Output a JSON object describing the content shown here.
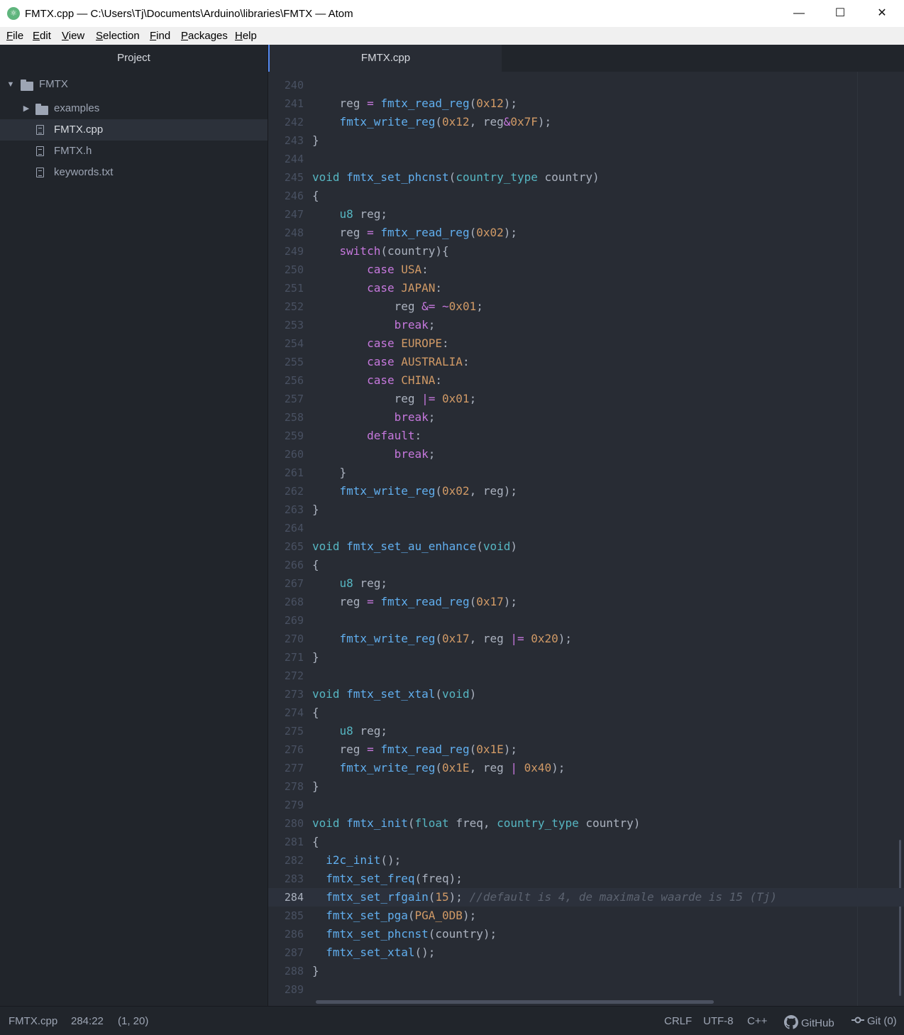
{
  "window": {
    "title": "FMTX.cpp — C:\\Users\\Tj\\Documents\\Arduino\\libraries\\FMTX — Atom",
    "app_icon": "atom-icon",
    "minimize": "—",
    "maximize": "☐",
    "close": "✕"
  },
  "menu": [
    {
      "key": "F",
      "rest": "ile"
    },
    {
      "key": "E",
      "rest": "dit"
    },
    {
      "key": "V",
      "rest": "iew"
    },
    {
      "key": "S",
      "rest": "election"
    },
    {
      "key": "F",
      "rest": "ind"
    },
    {
      "key": "P",
      "rest": "ackages"
    },
    {
      "key": "H",
      "rest": "elp"
    }
  ],
  "sidebar": {
    "header": "Project",
    "root": "FMTX",
    "items": [
      {
        "label": "examples",
        "type": "folder"
      },
      {
        "label": "FMTX.cpp",
        "type": "file",
        "selected": true
      },
      {
        "label": "FMTX.h",
        "type": "file"
      },
      {
        "label": "keywords.txt",
        "type": "file"
      }
    ]
  },
  "tab": {
    "label": "FMTX.cpp"
  },
  "editor": {
    "current_line": 284,
    "lines": [
      {
        "n": "240",
        "s": []
      },
      {
        "n": "241",
        "s": [
          [
            "p",
            "    reg "
          ],
          [
            "o",
            "="
          ],
          [
            "p",
            " "
          ],
          [
            "f",
            "fmtx_read_reg"
          ],
          [
            "p",
            "("
          ],
          [
            "n",
            "0x12"
          ],
          [
            "p",
            ");"
          ]
        ]
      },
      {
        "n": "242",
        "s": [
          [
            "p",
            "    "
          ],
          [
            "f",
            "fmtx_write_reg"
          ],
          [
            "p",
            "("
          ],
          [
            "n",
            "0x12"
          ],
          [
            "p",
            ", reg"
          ],
          [
            "o",
            "&"
          ],
          [
            "n",
            "0x7F"
          ],
          [
            "p",
            ");"
          ]
        ]
      },
      {
        "n": "243",
        "s": [
          [
            "p",
            "}"
          ]
        ]
      },
      {
        "n": "244",
        "s": []
      },
      {
        "n": "245",
        "s": [
          [
            "t",
            "void"
          ],
          [
            "p",
            " "
          ],
          [
            "f",
            "fmtx_set_phcnst"
          ],
          [
            "p",
            "("
          ],
          [
            "t",
            "country_type"
          ],
          [
            "p",
            " country)"
          ]
        ]
      },
      {
        "n": "246",
        "s": [
          [
            "p",
            "{"
          ]
        ]
      },
      {
        "n": "247",
        "s": [
          [
            "p",
            "    "
          ],
          [
            "t",
            "u8"
          ],
          [
            "p",
            " reg;"
          ]
        ]
      },
      {
        "n": "248",
        "s": [
          [
            "p",
            "    reg "
          ],
          [
            "o",
            "="
          ],
          [
            "p",
            " "
          ],
          [
            "f",
            "fmtx_read_reg"
          ],
          [
            "p",
            "("
          ],
          [
            "n",
            "0x02"
          ],
          [
            "p",
            ");"
          ]
        ]
      },
      {
        "n": "249",
        "s": [
          [
            "p",
            "    "
          ],
          [
            "k",
            "switch"
          ],
          [
            "p",
            "(country){"
          ]
        ]
      },
      {
        "n": "250",
        "s": [
          [
            "p",
            "        "
          ],
          [
            "k",
            "case"
          ],
          [
            "p",
            " "
          ],
          [
            "n",
            "USA"
          ],
          [
            "p",
            ":"
          ]
        ]
      },
      {
        "n": "251",
        "s": [
          [
            "p",
            "        "
          ],
          [
            "k",
            "case"
          ],
          [
            "p",
            " "
          ],
          [
            "n",
            "JAPAN"
          ],
          [
            "p",
            ":"
          ]
        ]
      },
      {
        "n": "252",
        "s": [
          [
            "p",
            "            reg "
          ],
          [
            "o",
            "&="
          ],
          [
            "p",
            " "
          ],
          [
            "o",
            "~"
          ],
          [
            "n",
            "0x01"
          ],
          [
            "p",
            ";"
          ]
        ]
      },
      {
        "n": "253",
        "s": [
          [
            "p",
            "            "
          ],
          [
            "k",
            "break"
          ],
          [
            "p",
            ";"
          ]
        ]
      },
      {
        "n": "254",
        "s": [
          [
            "p",
            "        "
          ],
          [
            "k",
            "case"
          ],
          [
            "p",
            " "
          ],
          [
            "n",
            "EUROPE"
          ],
          [
            "p",
            ":"
          ]
        ]
      },
      {
        "n": "255",
        "s": [
          [
            "p",
            "        "
          ],
          [
            "k",
            "case"
          ],
          [
            "p",
            " "
          ],
          [
            "n",
            "AUSTRALIA"
          ],
          [
            "p",
            ":"
          ]
        ]
      },
      {
        "n": "256",
        "s": [
          [
            "p",
            "        "
          ],
          [
            "k",
            "case"
          ],
          [
            "p",
            " "
          ],
          [
            "n",
            "CHINA"
          ],
          [
            "p",
            ":"
          ]
        ]
      },
      {
        "n": "257",
        "s": [
          [
            "p",
            "            reg "
          ],
          [
            "o",
            "|="
          ],
          [
            "p",
            " "
          ],
          [
            "n",
            "0x01"
          ],
          [
            "p",
            ";"
          ]
        ]
      },
      {
        "n": "258",
        "s": [
          [
            "p",
            "            "
          ],
          [
            "k",
            "break"
          ],
          [
            "p",
            ";"
          ]
        ]
      },
      {
        "n": "259",
        "s": [
          [
            "p",
            "        "
          ],
          [
            "k",
            "default"
          ],
          [
            "p",
            ":"
          ]
        ]
      },
      {
        "n": "260",
        "s": [
          [
            "p",
            "            "
          ],
          [
            "k",
            "break"
          ],
          [
            "p",
            ";"
          ]
        ]
      },
      {
        "n": "261",
        "s": [
          [
            "p",
            "    }"
          ]
        ]
      },
      {
        "n": "262",
        "s": [
          [
            "p",
            "    "
          ],
          [
            "f",
            "fmtx_write_reg"
          ],
          [
            "p",
            "("
          ],
          [
            "n",
            "0x02"
          ],
          [
            "p",
            ", reg);"
          ]
        ]
      },
      {
        "n": "263",
        "s": [
          [
            "p",
            "}"
          ]
        ]
      },
      {
        "n": "264",
        "s": []
      },
      {
        "n": "265",
        "s": [
          [
            "t",
            "void"
          ],
          [
            "p",
            " "
          ],
          [
            "f",
            "fmtx_set_au_enhance"
          ],
          [
            "p",
            "("
          ],
          [
            "t",
            "void"
          ],
          [
            "p",
            ")"
          ]
        ]
      },
      {
        "n": "266",
        "s": [
          [
            "p",
            "{"
          ]
        ]
      },
      {
        "n": "267",
        "s": [
          [
            "p",
            "    "
          ],
          [
            "t",
            "u8"
          ],
          [
            "p",
            " reg;"
          ]
        ]
      },
      {
        "n": "268",
        "s": [
          [
            "p",
            "    reg "
          ],
          [
            "o",
            "="
          ],
          [
            "p",
            " "
          ],
          [
            "f",
            "fmtx_read_reg"
          ],
          [
            "p",
            "("
          ],
          [
            "n",
            "0x17"
          ],
          [
            "p",
            ");"
          ]
        ]
      },
      {
        "n": "269",
        "s": []
      },
      {
        "n": "270",
        "s": [
          [
            "p",
            "    "
          ],
          [
            "f",
            "fmtx_write_reg"
          ],
          [
            "p",
            "("
          ],
          [
            "n",
            "0x17"
          ],
          [
            "p",
            ", reg "
          ],
          [
            "o",
            "|="
          ],
          [
            "p",
            " "
          ],
          [
            "n",
            "0x20"
          ],
          [
            "p",
            ");"
          ]
        ]
      },
      {
        "n": "271",
        "s": [
          [
            "p",
            "}"
          ]
        ]
      },
      {
        "n": "272",
        "s": []
      },
      {
        "n": "273",
        "s": [
          [
            "t",
            "void"
          ],
          [
            "p",
            " "
          ],
          [
            "f",
            "fmtx_set_xtal"
          ],
          [
            "p",
            "("
          ],
          [
            "t",
            "void"
          ],
          [
            "p",
            ")"
          ]
        ]
      },
      {
        "n": "274",
        "s": [
          [
            "p",
            "{"
          ]
        ]
      },
      {
        "n": "275",
        "s": [
          [
            "p",
            "    "
          ],
          [
            "t",
            "u8"
          ],
          [
            "p",
            " reg;"
          ]
        ]
      },
      {
        "n": "276",
        "s": [
          [
            "p",
            "    reg "
          ],
          [
            "o",
            "="
          ],
          [
            "p",
            " "
          ],
          [
            "f",
            "fmtx_read_reg"
          ],
          [
            "p",
            "("
          ],
          [
            "n",
            "0x1E"
          ],
          [
            "p",
            ");"
          ]
        ]
      },
      {
        "n": "277",
        "s": [
          [
            "p",
            "    "
          ],
          [
            "f",
            "fmtx_write_reg"
          ],
          [
            "p",
            "("
          ],
          [
            "n",
            "0x1E"
          ],
          [
            "p",
            ", reg "
          ],
          [
            "o",
            "|"
          ],
          [
            "p",
            " "
          ],
          [
            "n",
            "0x40"
          ],
          [
            "p",
            ");"
          ]
        ]
      },
      {
        "n": "278",
        "s": [
          [
            "p",
            "}"
          ]
        ]
      },
      {
        "n": "279",
        "s": []
      },
      {
        "n": "280",
        "s": [
          [
            "t",
            "void"
          ],
          [
            "p",
            " "
          ],
          [
            "f",
            "fmtx_init"
          ],
          [
            "p",
            "("
          ],
          [
            "t",
            "float"
          ],
          [
            "p",
            " freq, "
          ],
          [
            "t",
            "country_type"
          ],
          [
            "p",
            " country)"
          ]
        ]
      },
      {
        "n": "281",
        "s": [
          [
            "p",
            "{"
          ]
        ]
      },
      {
        "n": "282",
        "s": [
          [
            "p",
            "  "
          ],
          [
            "f",
            "i2c_init"
          ],
          [
            "p",
            "();"
          ]
        ]
      },
      {
        "n": "283",
        "s": [
          [
            "p",
            "  "
          ],
          [
            "f",
            "fmtx_set_freq"
          ],
          [
            "p",
            "(freq);"
          ]
        ]
      },
      {
        "n": "284",
        "s": [
          [
            "p",
            "  "
          ],
          [
            "f",
            "fmtx_set_rfgain"
          ],
          [
            "p",
            "("
          ],
          [
            "n",
            "15"
          ],
          [
            "p",
            ");"
          ],
          [
            "p",
            " "
          ],
          [
            "c",
            "//default is 4, de maximale waarde is 15 (Tj)"
          ]
        ]
      },
      {
        "n": "285",
        "s": [
          [
            "p",
            "  "
          ],
          [
            "f",
            "fmtx_set_pga"
          ],
          [
            "p",
            "("
          ],
          [
            "n",
            "PGA_0DB"
          ],
          [
            "p",
            ");"
          ]
        ]
      },
      {
        "n": "286",
        "s": [
          [
            "p",
            "  "
          ],
          [
            "f",
            "fmtx_set_phcnst"
          ],
          [
            "p",
            "(country);"
          ]
        ]
      },
      {
        "n": "287",
        "s": [
          [
            "p",
            "  "
          ],
          [
            "f",
            "fmtx_set_xtal"
          ],
          [
            "p",
            "();"
          ]
        ]
      },
      {
        "n": "288",
        "s": [
          [
            "p",
            "}"
          ]
        ]
      },
      {
        "n": "289",
        "s": []
      }
    ]
  },
  "status": {
    "file": "FMTX.cpp",
    "cursor": "284:22",
    "selection": "(1, 20)",
    "line_ending": "CRLF",
    "encoding": "UTF-8",
    "grammar": "C++",
    "github": "GitHub",
    "git": "Git (0)"
  }
}
